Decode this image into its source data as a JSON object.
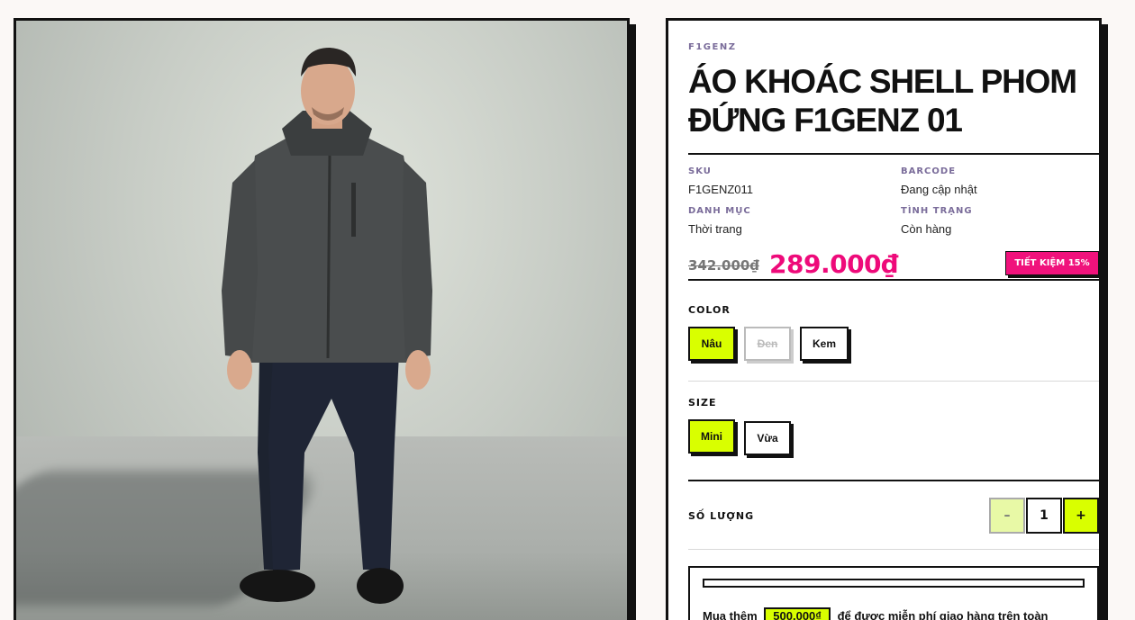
{
  "product": {
    "brand": "F1GENZ",
    "title": "ÁO KHOÁC SHELL PHOM ĐỨNG F1GENZ 01",
    "meta": {
      "sku_label": "SKU",
      "sku_value": "F1GENZ011",
      "barcode_label": "BARCODE",
      "barcode_value": "Đang cập nhật",
      "category_label": "DANH MỤC",
      "category_value": "Thời trang",
      "status_label": "TÌNH TRẠNG",
      "status_value": "Còn hàng"
    },
    "price": {
      "old": "342.000₫",
      "new": "289.000₫",
      "badge": "TIẾT KIỆM 15%"
    }
  },
  "options": {
    "color_label": "COLOR",
    "colors": [
      {
        "label": "Nâu",
        "state": "active"
      },
      {
        "label": "Đen",
        "state": "disabled"
      },
      {
        "label": "Kem",
        "state": "normal"
      }
    ],
    "size_label": "SIZE",
    "sizes": [
      {
        "label": "Mini",
        "state": "active"
      },
      {
        "label": "Vừa",
        "state": "normal"
      }
    ]
  },
  "quantity": {
    "label": "SỐ LƯỢNG",
    "minus": "–",
    "value": "1",
    "plus": "+"
  },
  "shipping": {
    "prefix": "Mua thêm",
    "amount": "500.000₫",
    "suffix": "để được miễn phí giao hàng trên toàn"
  },
  "colors": {
    "accent_lime": "#d9ff00",
    "accent_pink": "#ee0a7a",
    "label_purple": "#7a6c9a"
  }
}
